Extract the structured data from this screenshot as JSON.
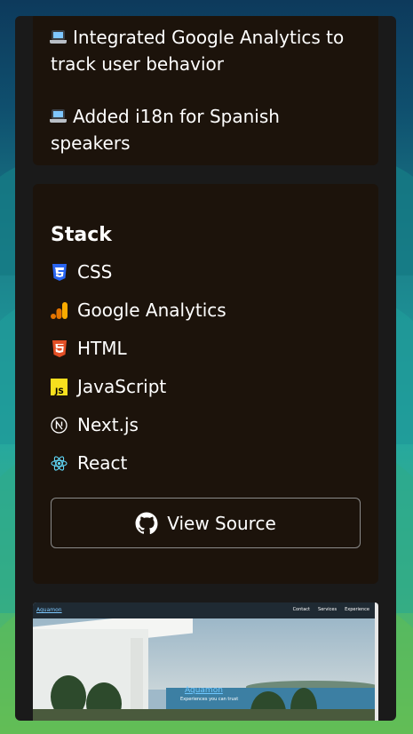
{
  "features": [
    {
      "icon": "laptop-icon",
      "line1": "Integrated Google Analytics to",
      "line2": "track user behavior"
    },
    {
      "icon": "laptop-icon",
      "line1": "Added i18n for Spanish speakers"
    }
  ],
  "stack": {
    "title": "Stack",
    "items": [
      {
        "label": "CSS",
        "icon": "css3-icon",
        "color": "#2965f1"
      },
      {
        "label": "Google Analytics",
        "icon": "google-analytics-icon",
        "color": "#f9ab00"
      },
      {
        "label": "HTML",
        "icon": "html5-icon",
        "color": "#e34f26"
      },
      {
        "label": "JavaScript",
        "icon": "javascript-icon",
        "color": "#f7df1e"
      },
      {
        "label": "Next.js",
        "icon": "nextjs-icon",
        "color": "#ffffff"
      },
      {
        "label": "React",
        "icon": "react-icon",
        "color": "#61dafb"
      }
    ],
    "view_source_label": "View Source"
  },
  "preview": {
    "brand": "Aquamon",
    "nav_links": [
      "Contact",
      "Services",
      "Experience"
    ],
    "hero_title": "Aquamon",
    "hero_subtitle": "Experiences you can trust"
  }
}
